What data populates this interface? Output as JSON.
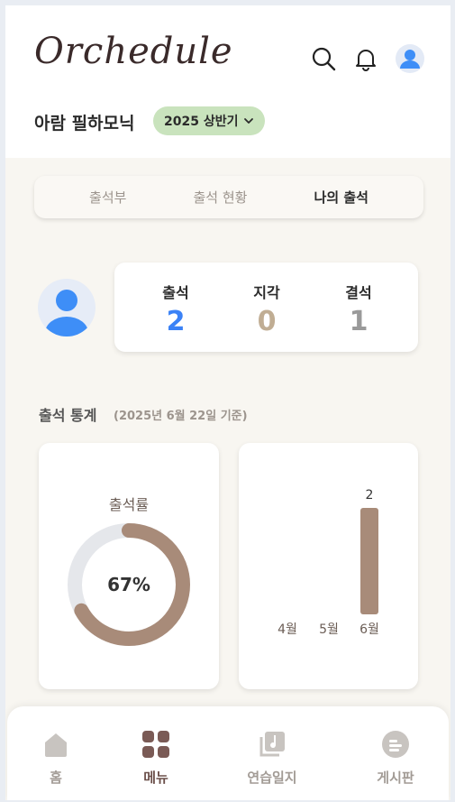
{
  "app": {
    "logo": "Orchedule",
    "org_name": "아람 필하모닉",
    "season": "2025 상반기"
  },
  "header_icons": [
    "search-icon",
    "bell-icon",
    "profile-avatar"
  ],
  "tabs": [
    {
      "label": "출석부",
      "active": false
    },
    {
      "label": "출석 현황",
      "active": false
    },
    {
      "label": "나의 출석",
      "active": true
    }
  ],
  "summary": {
    "attendance_label": "출석",
    "attendance_value": "2",
    "late_label": "지각",
    "late_value": "0",
    "absent_label": "결석",
    "absent_value": "1"
  },
  "stats": {
    "title": "출석 통계",
    "subtitle": "(2025년 6월 22일 기준)",
    "rate_label": "출석률",
    "rate_text": "67%"
  },
  "chart_data": [
    {
      "type": "pie",
      "title": "출석률",
      "values": [
        67,
        33
      ],
      "center_text": "67%",
      "colors": [
        "#a88b79",
        "#e5e7eb"
      ]
    },
    {
      "type": "bar",
      "categories": [
        "4월",
        "5월",
        "6월"
      ],
      "values": [
        0,
        0,
        2
      ],
      "data_labels": [
        "",
        "",
        "2"
      ],
      "ylim": [
        0,
        2
      ],
      "bar_color": "#a88b79"
    }
  ],
  "bottom_nav": [
    {
      "label": "홈",
      "icon": "home-icon",
      "active": false
    },
    {
      "label": "메뉴",
      "icon": "menu-grid-icon",
      "active": true
    },
    {
      "label": "연습일지",
      "icon": "music-note-icon",
      "active": false
    },
    {
      "label": "게시판",
      "icon": "board-icon",
      "active": false
    }
  ],
  "colors": {
    "attend": "#3b82f6",
    "late": "#c0ad93",
    "absent": "#9a9a9a",
    "accent": "#a88b79",
    "season_badge": "#c9e3bd"
  }
}
